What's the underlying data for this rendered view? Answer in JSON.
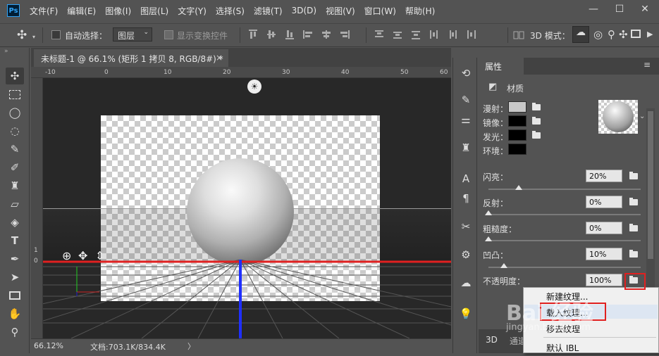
{
  "menubar": {
    "logo": "Ps",
    "items": [
      "文件(F)",
      "编辑(E)",
      "图像(I)",
      "图层(L)",
      "文字(Y)",
      "选择(S)",
      "滤镜(T)",
      "3D(D)",
      "视图(V)",
      "窗口(W)",
      "帮助(H)"
    ],
    "win_min": "—",
    "win_max": "☐",
    "win_close": "✕"
  },
  "options": {
    "move_icon": "✣",
    "auto_select_label": "自动选择：",
    "layer_select": "图层",
    "show_transform_label": "显示变换控件",
    "mode_label": "3D 模式：",
    "three_d_tools": [
      "☁",
      "◎",
      "⚲",
      "✣",
      "▶"
    ]
  },
  "document": {
    "tab_title": "未标题-1 @ 66.1% (矩形 1 拷贝 8, RGB/8#) *",
    "tab_close": "×",
    "ruler_top": [
      "-10",
      "0",
      "10",
      "20",
      "30",
      "40",
      "50",
      "60"
    ],
    "ruler_left": [
      "1",
      "0"
    ]
  },
  "status": {
    "zoom": "66.12%",
    "doc_info": "文档:703.1K/834.4K",
    "arrow": "〉"
  },
  "properties": {
    "tab": "属性",
    "section": "材质",
    "maps": [
      {
        "label": "漫射：",
        "color": "#c8c8c8"
      },
      {
        "label": "镜像：",
        "color": "#000000"
      },
      {
        "label": "发光：",
        "color": "#000000"
      },
      {
        "label": "环境：",
        "color": "#000000"
      }
    ],
    "sliders": [
      {
        "label": "闪亮：",
        "value": "20%",
        "fraction": 0.2
      },
      {
        "label": "反射：",
        "value": "0%",
        "fraction": 0
      },
      {
        "label": "粗糙度：",
        "value": "0%",
        "fraction": 0
      },
      {
        "label": "凹凸：",
        "value": "10%",
        "fraction": 0.1
      },
      {
        "label": "不透明度：",
        "value": "100%",
        "fraction": 1
      }
    ],
    "bottom_tabs": [
      "3D",
      "通道"
    ]
  },
  "context_menu": {
    "items": [
      "新建纹理...",
      "载入纹理...",
      "移去纹理",
      "默认 IBL"
    ]
  },
  "watermark": {
    "text1": "Bai 经验",
    "text2": "jingyan.baidu.com"
  },
  "colors": {
    "accent": "#e02020",
    "panel": "#535353",
    "canvas": "#282828",
    "ps_blue": "#2fa3f7"
  }
}
